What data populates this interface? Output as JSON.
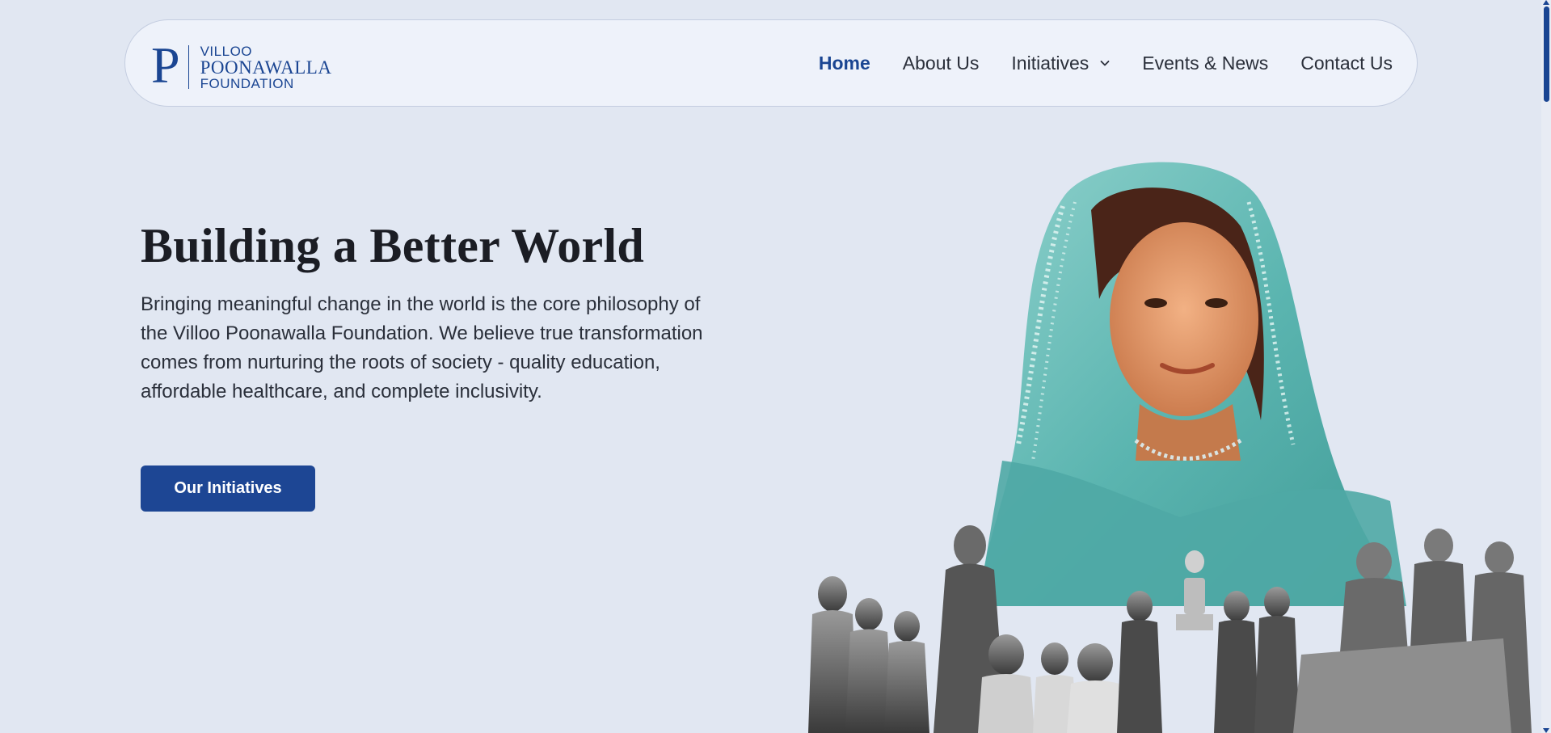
{
  "logo": {
    "mark": "P",
    "line1": "VILLOO",
    "line2": "POONAWALLA",
    "line3": "FOUNDATION"
  },
  "nav": {
    "items": [
      {
        "label": "Home",
        "active": true
      },
      {
        "label": "About Us"
      },
      {
        "label": "Initiatives",
        "has_dropdown": true
      },
      {
        "label": "Events & News"
      },
      {
        "label": "Contact Us"
      }
    ]
  },
  "hero": {
    "title": "Building a Better World",
    "description": "Bringing meaningful change in the world is the core philosophy of the Villoo Poonawalla Foundation. We believe true transformation comes from nurturing the roots of society - quality education, affordable healthcare, and complete inclusivity.",
    "cta_label": "Our Initiatives"
  },
  "colors": {
    "background": "#e1e7f2",
    "brand": "#1a4592",
    "button": "#1d4694"
  },
  "icons": {
    "dropdown": "chevron-down-icon"
  }
}
